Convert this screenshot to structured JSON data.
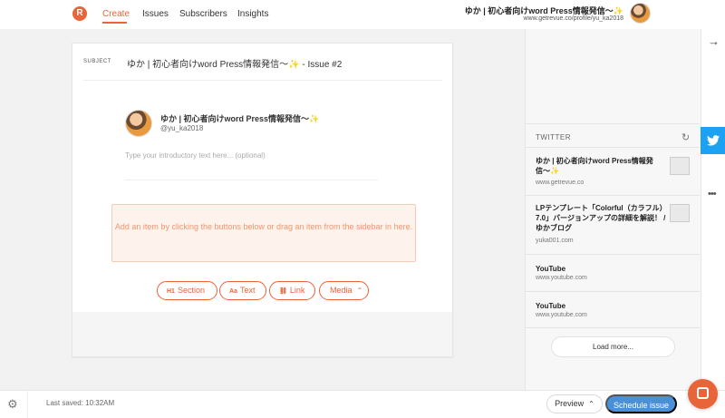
{
  "nav": {
    "logo": "R",
    "items": [
      "Create",
      "Issues",
      "Subscribers",
      "Insights"
    ],
    "active": "Create"
  },
  "profile": {
    "name": "ゆか | 初心者向けword Press情報発信〜✨",
    "url": "www.getrevue.co/profile/yu_ka2018"
  },
  "editor": {
    "subject_label": "SUBJECT",
    "subject": "ゆか | 初心者向けword Press情報発信〜✨ - Issue #2",
    "sender_name": "ゆか | 初心者向けword Press情報発信〜✨",
    "sender_handle": "@yu_ka2018",
    "intro_placeholder": "Type your introductory text here... (optional)",
    "drop_zone_text": "Add an item by clicking the buttons below or drag an item from the sidebar in here.",
    "buttons": {
      "section": "Section",
      "text": "Text",
      "link": "Link",
      "media": "Media"
    },
    "button_icons": {
      "section": "H1",
      "text": "Aa"
    }
  },
  "sidebar": {
    "header": "TWITTER",
    "items": [
      {
        "title": "ゆか | 初心者向けword Press情報発信〜✨",
        "sub": "www.getrevue.co"
      },
      {
        "title": "LPテンプレート「Colorful（カラフル）7.0」バージョンアップの詳細を解説！ / ゆかブログ",
        "sub": "yuka001.com"
      },
      {
        "title": "YouTube",
        "sub": "www.youtube.com"
      },
      {
        "title": "YouTube",
        "sub": "www.youtube.com"
      }
    ],
    "load_more": "Load more..."
  },
  "footer": {
    "last_saved": "Last saved: 10:32AM",
    "preview": "Preview",
    "schedule": "Schedule issue"
  },
  "colors": {
    "accent": "#e8653a",
    "twitter": "#1da1f2",
    "schedule": "#4a90d9"
  },
  "icons": [
    "revue-logo-icon",
    "refresh-icon",
    "arrow-right-icon",
    "twitter-icon",
    "more-dots-icon",
    "gear-icon",
    "chat-icon",
    "link-icon",
    "chevron-up-icon"
  ]
}
